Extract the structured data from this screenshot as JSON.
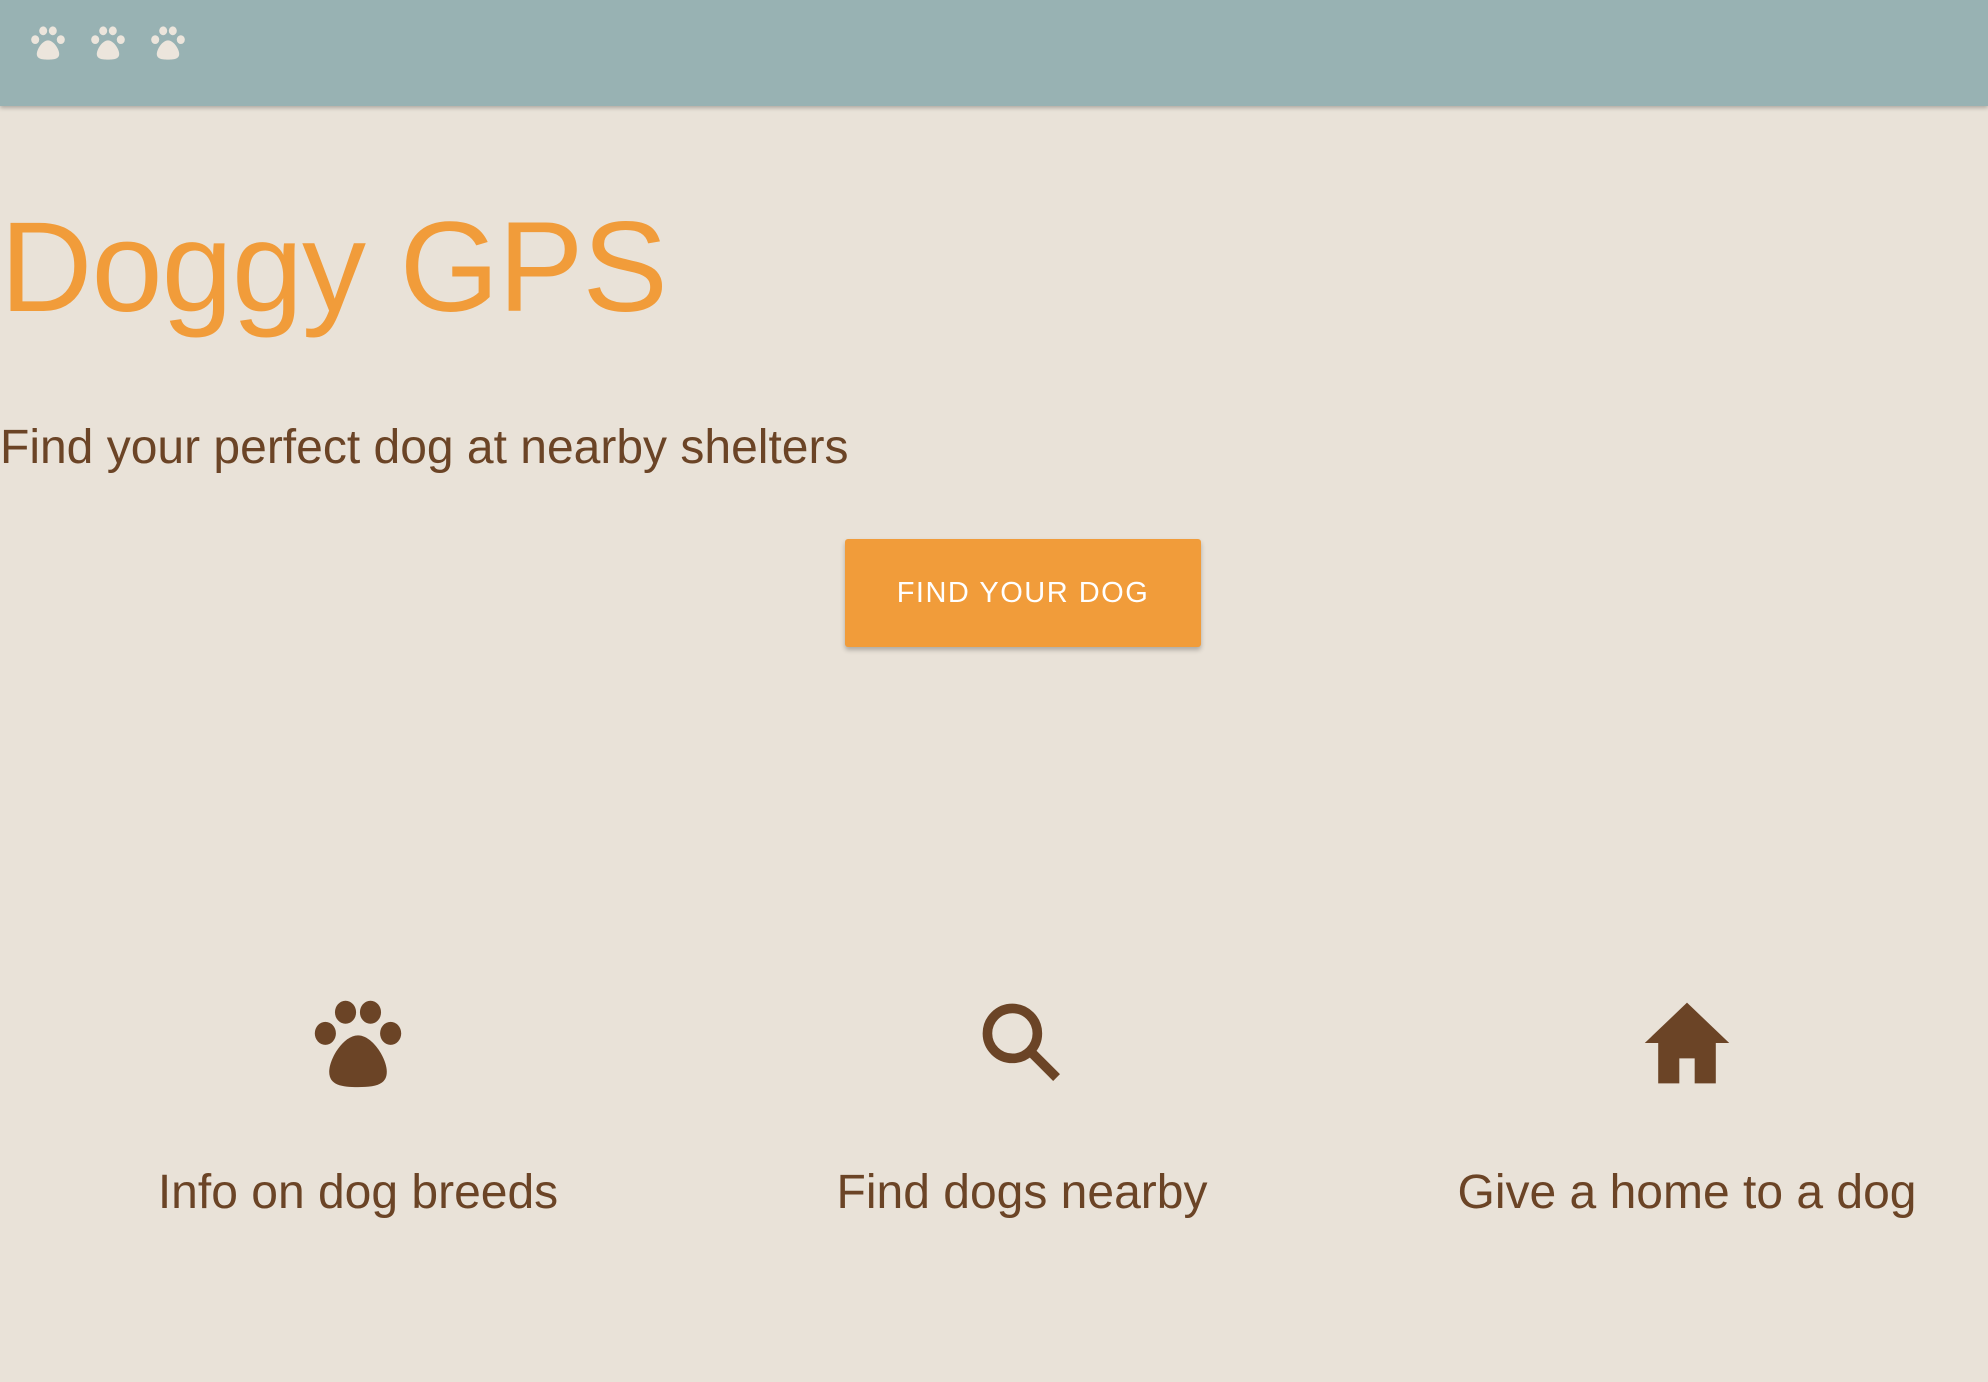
{
  "header": {
    "logo_icons": [
      "paw-icon",
      "paw-icon",
      "paw-icon"
    ],
    "bg_color": "#98b2b3"
  },
  "hero": {
    "title": "Doggy GPS",
    "subtitle": "Find your perfect dog at nearby shelters",
    "cta_label": "FIND YOUR DOG"
  },
  "features": [
    {
      "icon": "paw-icon",
      "label": "Info on dog breeds"
    },
    {
      "icon": "search-icon",
      "label": "Find dogs nearby"
    },
    {
      "icon": "home-icon",
      "label": "Give a home to a dog"
    }
  ],
  "colors": {
    "accent": "#f19c3a",
    "text_brown": "#6b4426",
    "background": "#e9e2d8",
    "header_bg": "#98b2b3",
    "header_icon": "#ece5dc"
  }
}
